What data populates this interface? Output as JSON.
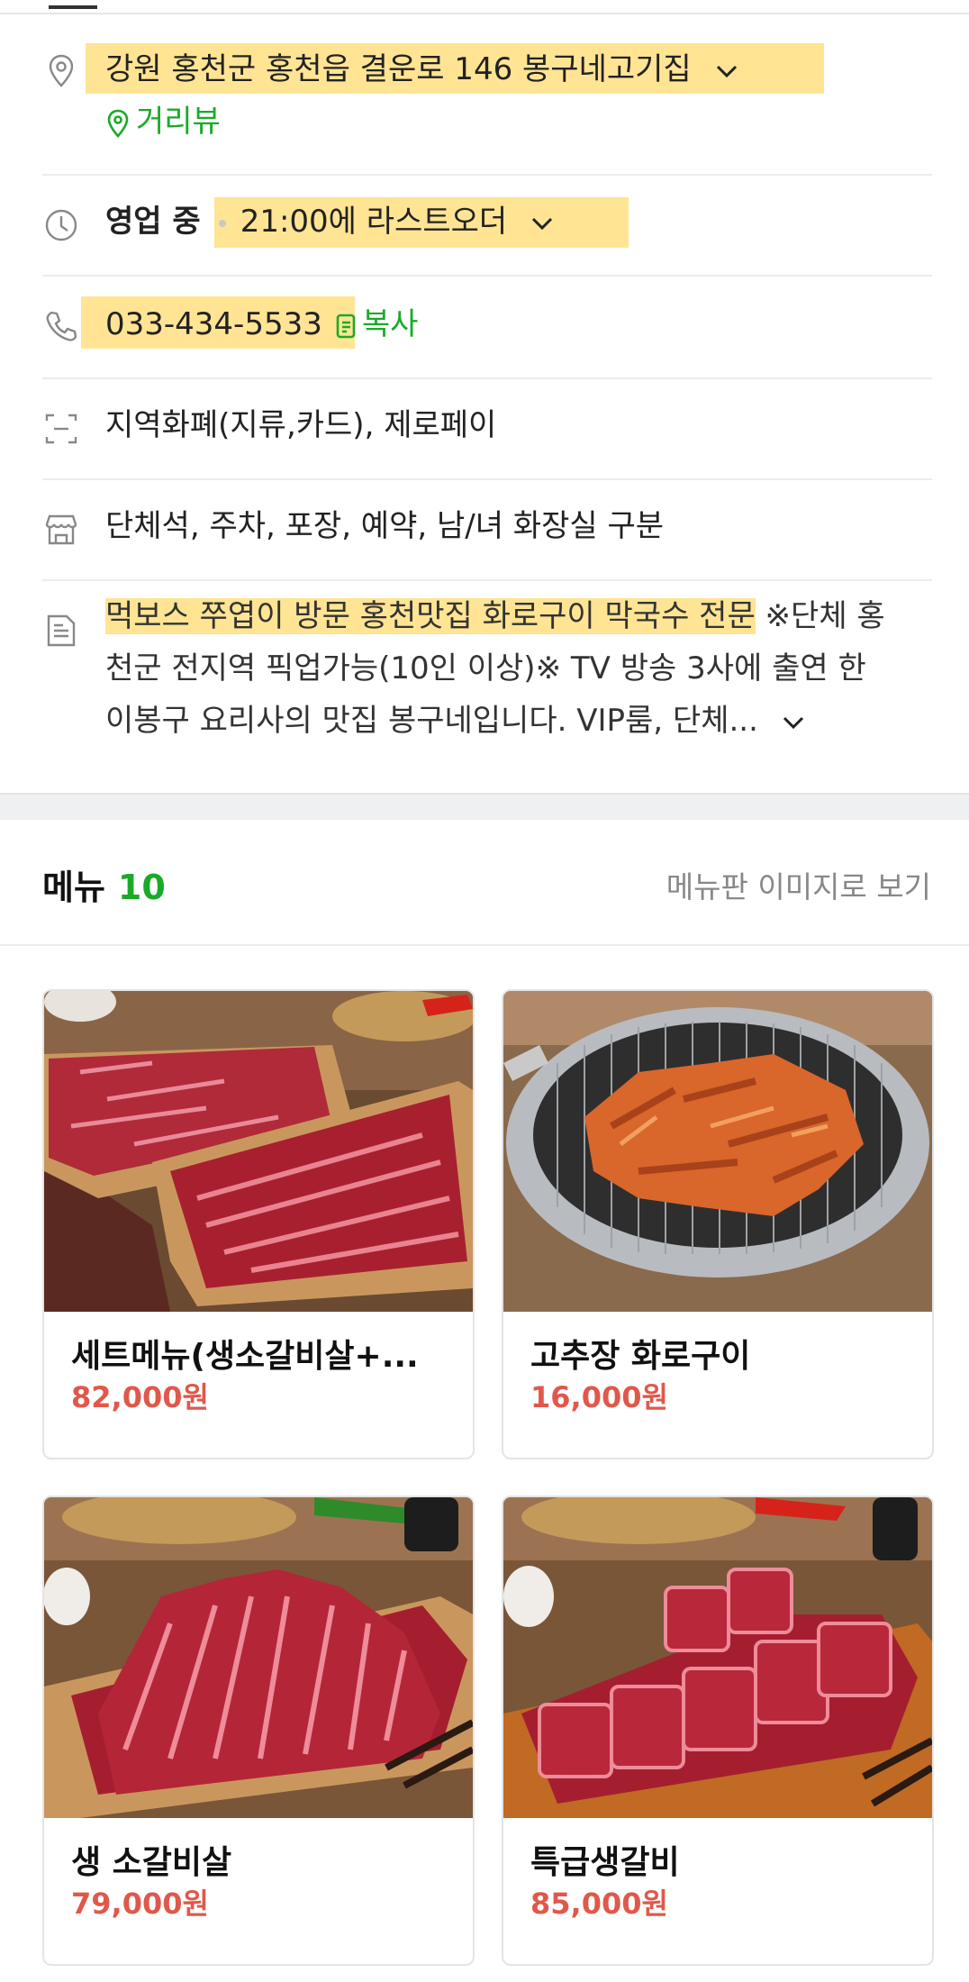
{
  "info": {
    "address": "강원 홍천군 홍천읍 결운로 146 봉구네고기집",
    "street_view_label": "거리뷰",
    "open_status": "영업 중",
    "last_order": "21:00에 라스트오더",
    "phone": "033-434-5533",
    "copy_label": "복사",
    "payment": "지역화폐(지류,카드), 제로페이",
    "facilities": "단체석, 주차, 포장, 예약, 남/녀 화장실 구분",
    "description_highlight": "먹보스 쭈엽이 방문 홍천맛집 화로구이 막국수 전문",
    "description_line1_rest": "※단체 홍",
    "description_line2": "천군 전지역 픽업가능(10인 이상)※ TV 방송 3사에 출연 한",
    "description_line3": "이봉구 요리사의 맛집 봉구네입니다. VIP룸, 단체..."
  },
  "menu": {
    "title": "메뉴",
    "count": "10",
    "board_link": "메뉴판 이미지로 보기",
    "items": [
      {
        "name": "세트메뉴(생소갈비살+...",
        "price": "82,000원"
      },
      {
        "name": "고추장 화로구이",
        "price": "16,000원"
      },
      {
        "name": "생 소갈비살",
        "price": "79,000원"
      },
      {
        "name": "특급생갈비",
        "price": "85,000원"
      }
    ]
  },
  "colors": {
    "accent_green": "#1aaa28",
    "highlight_yellow": "#ffe493",
    "price_red": "#e0584b"
  }
}
